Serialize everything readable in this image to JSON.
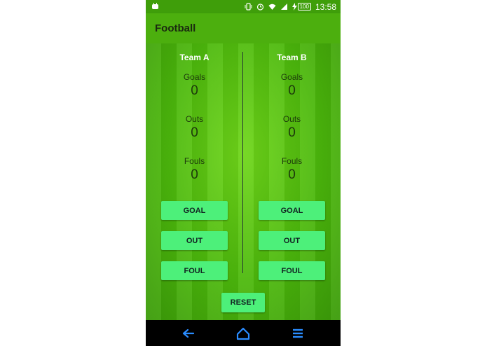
{
  "status": {
    "battery": "100",
    "time": "13:58"
  },
  "app": {
    "title": "Football"
  },
  "teams": [
    {
      "name": "Team A",
      "goals_label": "Goals",
      "goals": "0",
      "outs_label": "Outs",
      "outs": "0",
      "fouls_label": "Fouls",
      "fouls": "0",
      "buttons": {
        "goal": "GOAL",
        "out": "OUT",
        "foul": "FOUL"
      }
    },
    {
      "name": "Team B",
      "goals_label": "Goals",
      "goals": "0",
      "outs_label": "Outs",
      "outs": "0",
      "fouls_label": "Fouls",
      "fouls": "0",
      "buttons": {
        "goal": "GOAL",
        "out": "OUT",
        "foul": "FOUL"
      }
    }
  ],
  "reset_label": "RESET",
  "nav": {
    "icons": [
      "back-icon",
      "home-icon",
      "menu-icon"
    ]
  },
  "colors": {
    "appbar": "#4caf0e",
    "statusbar": "#3f9e0a",
    "button": "#4df07a",
    "nav_icon": "#2a8cff"
  }
}
